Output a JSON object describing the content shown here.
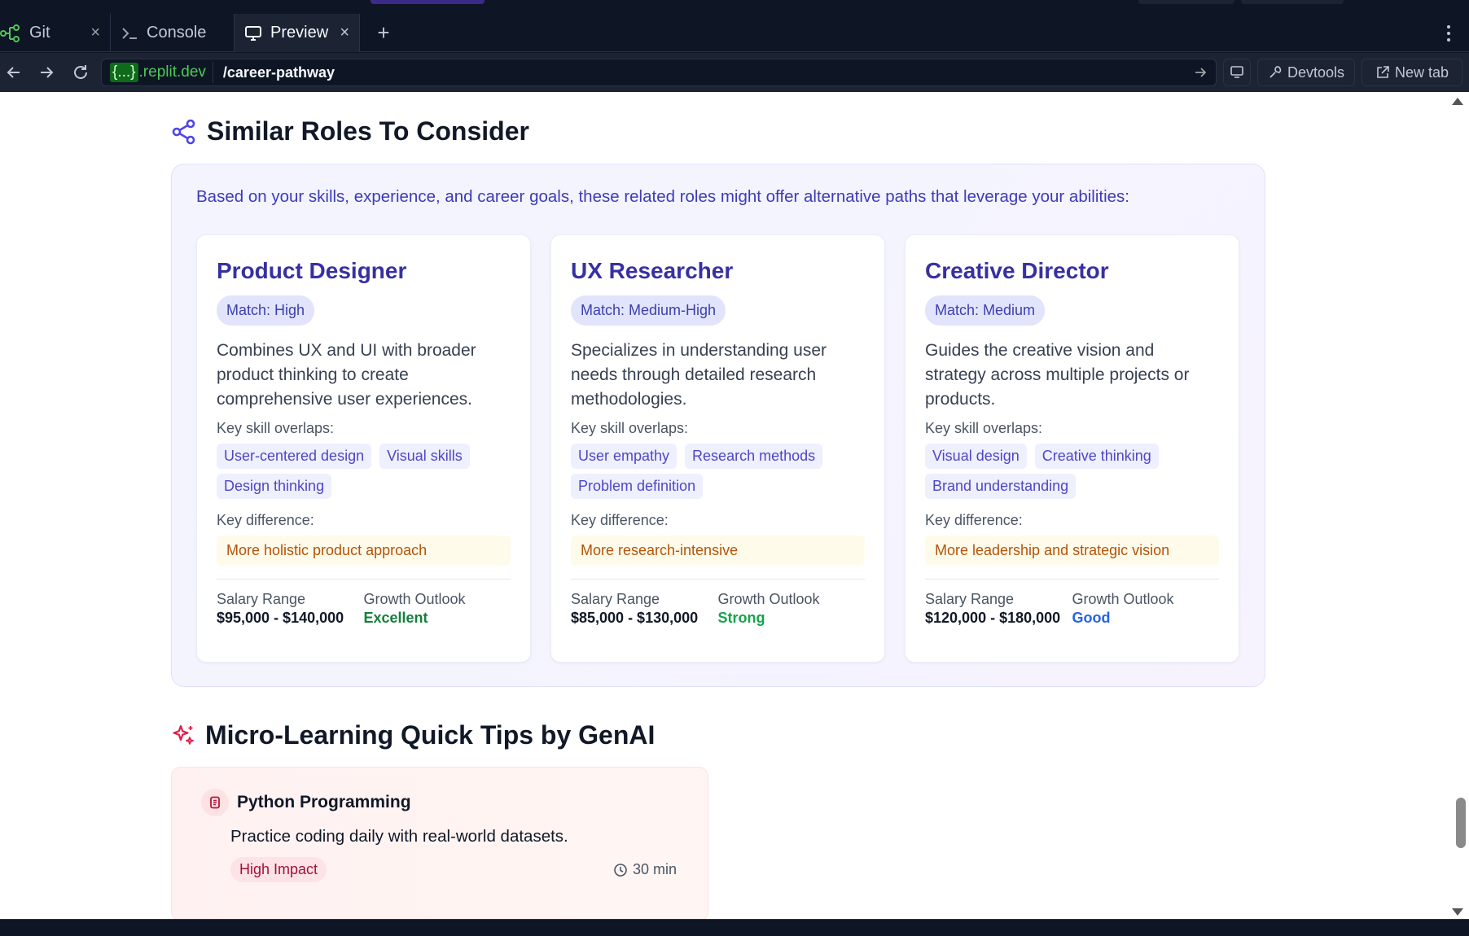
{
  "tabs": [
    {
      "label": "Git",
      "icon": "git-branch-icon"
    },
    {
      "label": "Console",
      "icon": "terminal-icon"
    },
    {
      "label": "Preview",
      "icon": "monitor-icon"
    }
  ],
  "addressbar": {
    "host_brace": "{...}",
    "host_suffix": ".replit.dev",
    "path": "/career-pathway",
    "devtools_label": "Devtools",
    "newtab_label": "New tab"
  },
  "similar_roles": {
    "title": "Similar Roles To Consider",
    "intro": "Based on your skills, experience, and career goals, these related roles might offer alternative paths that leverage your abilities:",
    "skill_overlaps_label": "Key skill overlaps:",
    "difference_label": "Key difference:",
    "salary_label": "Salary Range",
    "growth_label": "Growth Outlook",
    "roles": [
      {
        "title": "Product Designer",
        "match": "Match: High",
        "description": "Combines UX and UI with broader product thinking to create comprehensive user experiences.",
        "skills": [
          "User-centered design",
          "Visual skills",
          "Design thinking"
        ],
        "difference": "More holistic product approach",
        "salary": "$95,000 - $140,000",
        "growth": "Excellent",
        "growth_color": "#15803d"
      },
      {
        "title": "UX Researcher",
        "match": "Match: Medium-High",
        "description": "Specializes in understanding user needs through detailed research methodologies.",
        "skills": [
          "User empathy",
          "Research methods",
          "Problem definition"
        ],
        "difference": "More research-intensive",
        "salary": "$85,000 - $130,000",
        "growth": "Strong",
        "growth_color": "#16a34a"
      },
      {
        "title": "Creative Director",
        "match": "Match: Medium",
        "description": "Guides the creative vision and strategy across multiple projects or products.",
        "skills": [
          "Visual design",
          "Creative thinking",
          "Brand understanding"
        ],
        "difference": "More leadership and strategic vision",
        "salary": "$120,000 - $180,000",
        "growth": "Good",
        "growth_color": "#2563eb"
      }
    ]
  },
  "micro_learning": {
    "title": "Micro-Learning Quick Tips by GenAI",
    "tips": [
      {
        "topic": "Python Programming",
        "tip": "Practice coding daily with real-world datasets.",
        "impact": "High Impact",
        "duration": "30 min"
      }
    ]
  }
}
